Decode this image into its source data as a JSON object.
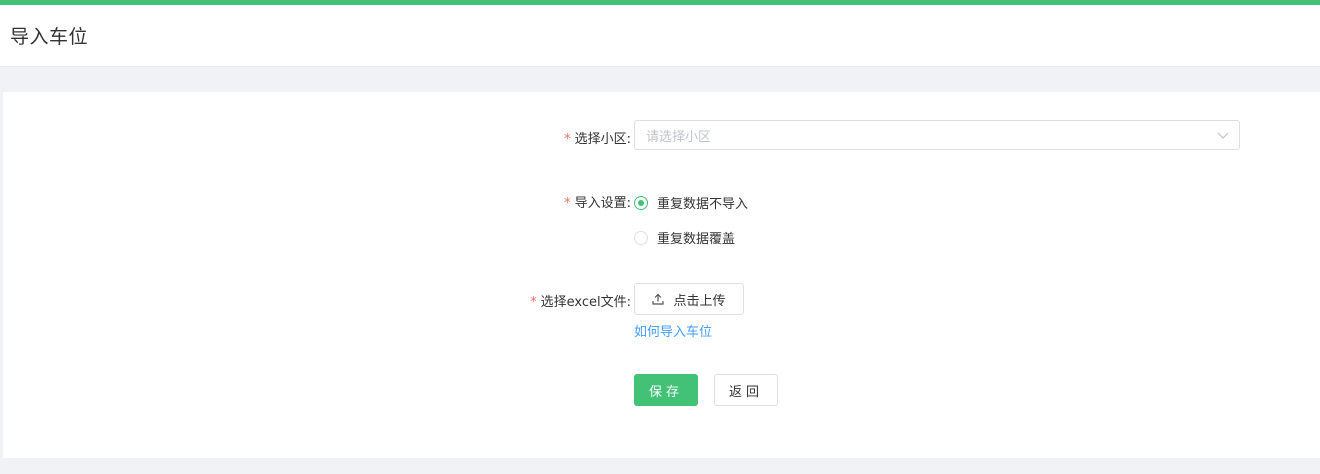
{
  "header": {
    "title": "导入车位"
  },
  "form": {
    "community": {
      "label": "选择小区:",
      "placeholder": "请选择小区"
    },
    "import_setting": {
      "label": "导入设置:",
      "options": [
        {
          "label": "重复数据不导入",
          "checked": true
        },
        {
          "label": "重复数据覆盖",
          "checked": false
        }
      ]
    },
    "excel_file": {
      "label": "选择excel文件:",
      "upload_label": "点击上传",
      "help_link": "如何导入车位"
    },
    "required_mark": "*"
  },
  "actions": {
    "save_label": "保存",
    "back_label": "返回"
  },
  "colors": {
    "accent": "#42c177",
    "link": "#409eff",
    "required": "#f56c6c"
  }
}
